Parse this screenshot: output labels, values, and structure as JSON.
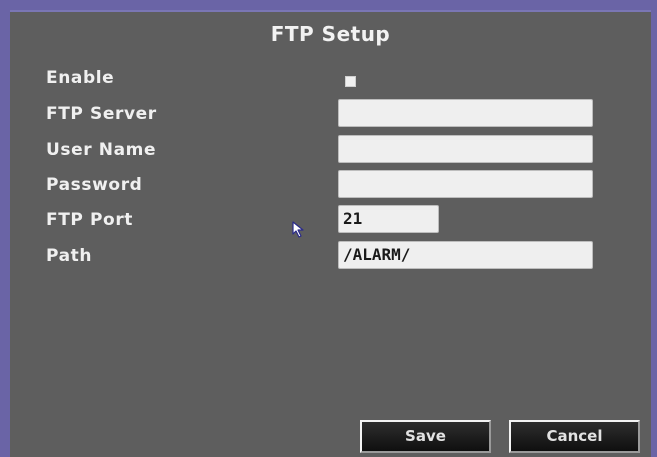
{
  "window": {
    "title": "FTP Setup"
  },
  "form": {
    "enable": {
      "label": "Enable",
      "checked": true
    },
    "ftp_server": {
      "label": "FTP Server",
      "value": ""
    },
    "user_name": {
      "label": "User Name",
      "value": ""
    },
    "password": {
      "label": "Password",
      "value": ""
    },
    "ftp_port": {
      "label": "FTP Port",
      "value": "21"
    },
    "path": {
      "label": "Path",
      "value": "/ALARM/"
    }
  },
  "buttons": {
    "save": "Save",
    "cancel": "Cancel"
  },
  "colors": {
    "frame": "#6a64a6",
    "panel": "#5e5e5e",
    "field": "#efefef",
    "button": "#1c1c1c"
  },
  "icons": {
    "cursor": "mouse-pointer-icon"
  }
}
